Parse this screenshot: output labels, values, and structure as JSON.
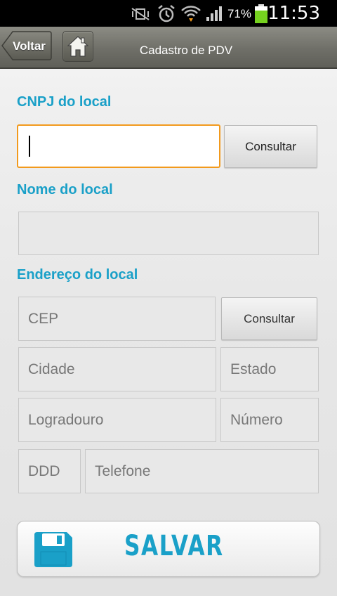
{
  "status_bar": {
    "battery_percent": "71%",
    "time": "11:53"
  },
  "header": {
    "back_label": "Voltar",
    "title": "Cadastro de PDV"
  },
  "cnpj": {
    "label": "CNPJ  do local",
    "input_value": "",
    "consult_label": "Consultar"
  },
  "nome": {
    "label": "Nome  do local",
    "input_value": ""
  },
  "endereco": {
    "label": "Endereço do local",
    "cep_placeholder": "CEP",
    "consult_label": "Consultar",
    "cidade_placeholder": "Cidade",
    "estado_placeholder": "Estado",
    "logradouro_placeholder": "Logradouro",
    "numero_placeholder": "Número",
    "ddd_placeholder": "DDD",
    "telefone_placeholder": "Telefone"
  },
  "save": {
    "label": "SALVAR"
  },
  "colors": {
    "accent": "#1aa0c8",
    "focus_border": "#f29a1d",
    "battery": "#76d21f"
  }
}
